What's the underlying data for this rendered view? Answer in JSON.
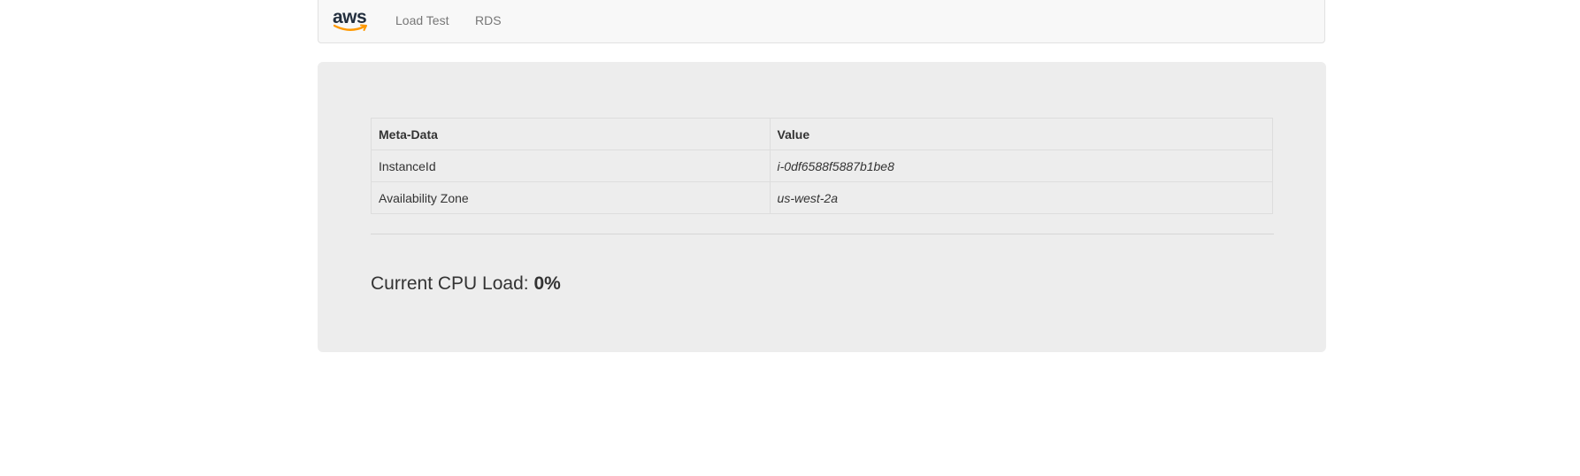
{
  "navbar": {
    "brand_text": "aws",
    "brand_colors": {
      "text": "#232f3e",
      "smile": "#ff9900"
    },
    "links": [
      {
        "label": "Load Test"
      },
      {
        "label": "RDS"
      }
    ]
  },
  "metadata_table": {
    "headers": [
      "Meta-Data",
      "Value"
    ],
    "rows": [
      {
        "key": "InstanceId",
        "value": "i-0df6588f5887b1be8"
      },
      {
        "key": "Availability Zone",
        "value": "us-west-2a"
      }
    ]
  },
  "cpu": {
    "label": "Current CPU Load:",
    "value": "0%"
  }
}
